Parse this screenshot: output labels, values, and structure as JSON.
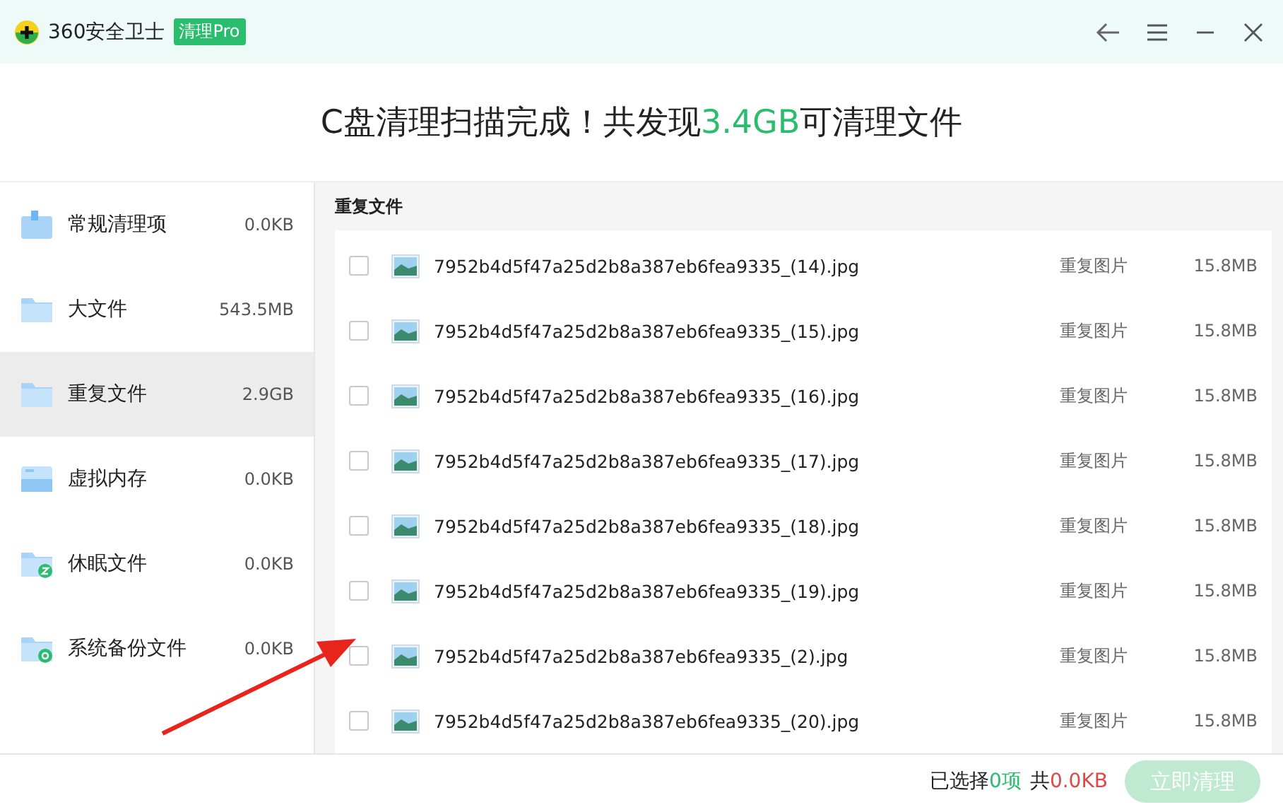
{
  "window": {
    "app_name": "360安全卫士",
    "badge": "清理Pro"
  },
  "headline": {
    "before": "C盘清理扫描完成！共发现",
    "highlight": "3.4GB",
    "after": "可清理文件"
  },
  "sidebar": {
    "items": [
      {
        "kind": "doc",
        "label": "常规清理项",
        "size": "0.0KB",
        "selected": false
      },
      {
        "kind": "folder",
        "label": "大文件",
        "size": "543.5MB",
        "selected": false
      },
      {
        "kind": "folder",
        "label": "重复文件",
        "size": "2.9GB",
        "selected": true
      },
      {
        "kind": "memory",
        "label": "虚拟内存",
        "size": "0.0KB",
        "selected": false
      },
      {
        "kind": "hibernate",
        "label": "休眠文件",
        "size": "0.0KB",
        "selected": false
      },
      {
        "kind": "backup",
        "label": "系统备份文件",
        "size": "0.0KB",
        "selected": false
      }
    ]
  },
  "list": {
    "title": "重复文件",
    "rows": [
      {
        "name": "7952b4d5f47a25d2b8a387eb6fea9335_(14).jpg",
        "type": "重复图片",
        "size": "15.8MB",
        "checked": false
      },
      {
        "name": "7952b4d5f47a25d2b8a387eb6fea9335_(15).jpg",
        "type": "重复图片",
        "size": "15.8MB",
        "checked": false
      },
      {
        "name": "7952b4d5f47a25d2b8a387eb6fea9335_(16).jpg",
        "type": "重复图片",
        "size": "15.8MB",
        "checked": false
      },
      {
        "name": "7952b4d5f47a25d2b8a387eb6fea9335_(17).jpg",
        "type": "重复图片",
        "size": "15.8MB",
        "checked": false
      },
      {
        "name": "7952b4d5f47a25d2b8a387eb6fea9335_(18).jpg",
        "type": "重复图片",
        "size": "15.8MB",
        "checked": false
      },
      {
        "name": "7952b4d5f47a25d2b8a387eb6fea9335_(19).jpg",
        "type": "重复图片",
        "size": "15.8MB",
        "checked": false
      },
      {
        "name": "7952b4d5f47a25d2b8a387eb6fea9335_(2).jpg",
        "type": "重复图片",
        "size": "15.8MB",
        "checked": false
      },
      {
        "name": "7952b4d5f47a25d2b8a387eb6fea9335_(20).jpg",
        "type": "重复图片",
        "size": "15.8MB",
        "checked": false
      }
    ]
  },
  "footer": {
    "selected_prefix": "已选择",
    "selected_count": "0项",
    "total_prefix": "共",
    "total_size": "0.0KB",
    "button": {
      "label": "立即清理",
      "disabled": true
    }
  }
}
